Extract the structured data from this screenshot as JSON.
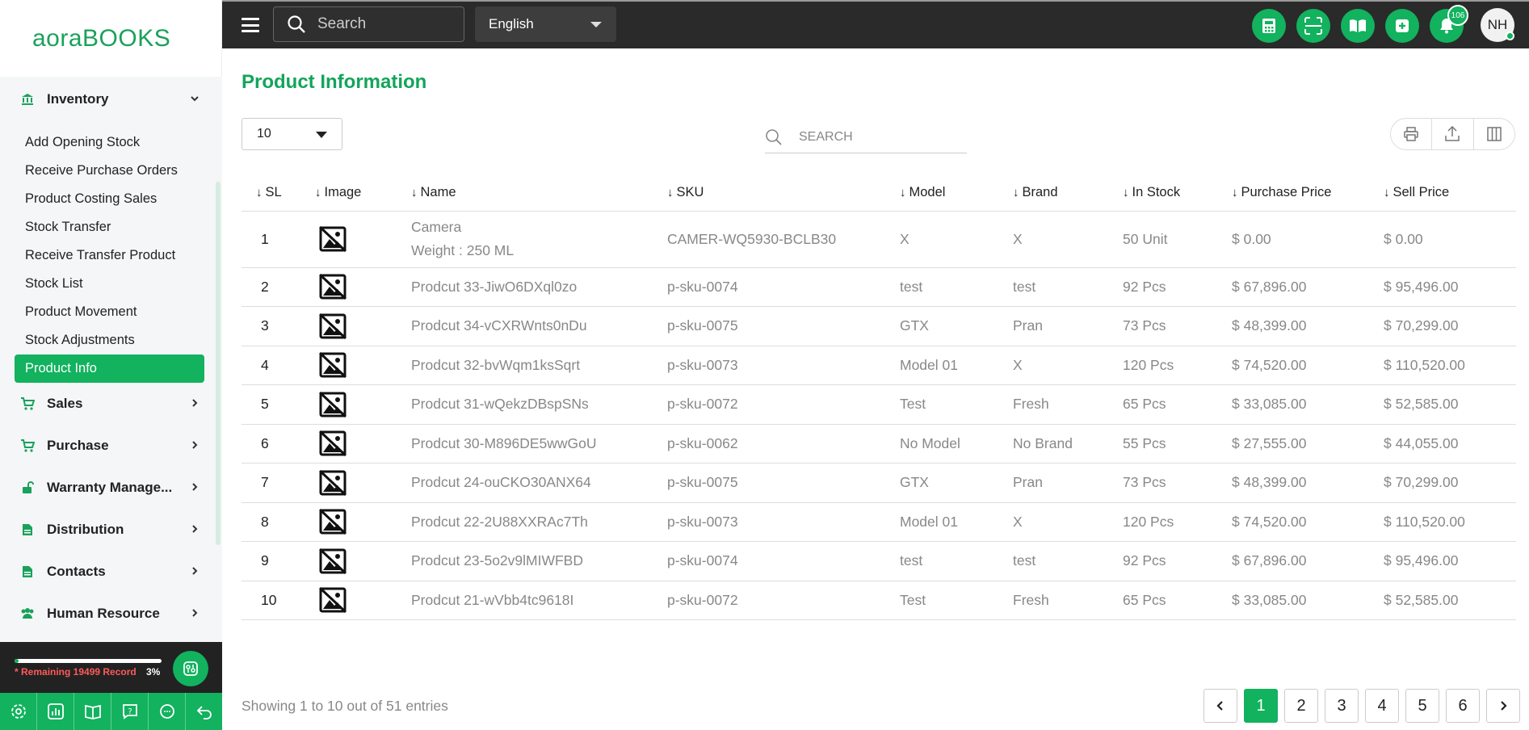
{
  "brand": {
    "logo_part1": "aora",
    "logo_part2": "BOOKS",
    "accent": "#12b25e"
  },
  "topbar": {
    "search_placeholder": "Search",
    "language": "English",
    "notification_count": "106",
    "avatar_initials": "NH"
  },
  "sidebar": {
    "groups": [
      {
        "label": "Inventory",
        "icon": "bank-icon",
        "expanded": true
      },
      {
        "label": "Sales",
        "icon": "cart-icon"
      },
      {
        "label": "Purchase",
        "icon": "cart-icon"
      },
      {
        "label": "Warranty Manage...",
        "icon": "unlock-icon"
      },
      {
        "label": "Distribution",
        "icon": "document-icon"
      },
      {
        "label": "Contacts",
        "icon": "document-icon"
      },
      {
        "label": "Human Resource",
        "icon": "users-icon"
      }
    ],
    "inventory_items": [
      "Add Opening Stock",
      "Receive Purchase Orders",
      "Product Costing Sales",
      "Stock Transfer",
      "Receive Transfer Product",
      "Stock List",
      "Product Movement",
      "Stock Adjustments",
      "Product Info"
    ],
    "active_item": "Product Info",
    "usage": {
      "remaining_text": "* Remaining 19499 Record",
      "percent_text": "3%",
      "percent": 3
    }
  },
  "main": {
    "title": "Product Information",
    "per_page": "10",
    "search_placeholder": "SEARCH",
    "columns": [
      "SL",
      "Image",
      "Name",
      "SKU",
      "Model",
      "Brand",
      "In Stock",
      "Purchase Price",
      "Sell Price"
    ],
    "rows": [
      {
        "sl": "1",
        "name": "Camera",
        "name2": "Weight : 250 ML",
        "sku": "CAMER-WQ5930-BCLB30",
        "model": "X",
        "brand": "X",
        "stock": "50 Unit",
        "purchase": "$ 0.00",
        "sell": "$ 0.00"
      },
      {
        "sl": "2",
        "name": "Prodcut 33-JiwO6DXql0zo",
        "sku": "p-sku-0074",
        "model": "test",
        "brand": "test",
        "stock": "92 Pcs",
        "purchase": "$ 67,896.00",
        "sell": "$ 95,496.00"
      },
      {
        "sl": "3",
        "name": "Prodcut 34-vCXRWnts0nDu",
        "sku": "p-sku-0075",
        "model": "GTX",
        "brand": "Pran",
        "stock": "73 Pcs",
        "purchase": "$ 48,399.00",
        "sell": "$ 70,299.00"
      },
      {
        "sl": "4",
        "name": "Prodcut 32-bvWqm1ksSqrt",
        "sku": "p-sku-0073",
        "model": "Model 01",
        "brand": "X",
        "stock": "120 Pcs",
        "purchase": "$ 74,520.00",
        "sell": "$ 110,520.00"
      },
      {
        "sl": "5",
        "name": "Prodcut 31-wQekzDBspSNs",
        "sku": "p-sku-0072",
        "model": "Test",
        "brand": "Fresh",
        "stock": "65 Pcs",
        "purchase": "$ 33,085.00",
        "sell": "$ 52,585.00"
      },
      {
        "sl": "6",
        "name": "Prodcut 30-M896DE5wwGoU",
        "sku": "p-sku-0062",
        "model": "No Model",
        "brand": "No Brand",
        "stock": "55 Pcs",
        "purchase": "$ 27,555.00",
        "sell": "$ 44,055.00"
      },
      {
        "sl": "7",
        "name": "Prodcut 24-ouCKO30ANX64",
        "sku": "p-sku-0075",
        "model": "GTX",
        "brand": "Pran",
        "stock": "73 Pcs",
        "purchase": "$ 48,399.00",
        "sell": "$ 70,299.00"
      },
      {
        "sl": "8",
        "name": "Prodcut 22-2U88XXRAc7Th",
        "sku": "p-sku-0073",
        "model": "Model 01",
        "brand": "X",
        "stock": "120 Pcs",
        "purchase": "$ 74,520.00",
        "sell": "$ 110,520.00"
      },
      {
        "sl": "9",
        "name": "Prodcut 23-5o2v9lMIWFBD",
        "sku": "p-sku-0074",
        "model": "test",
        "brand": "test",
        "stock": "92 Pcs",
        "purchase": "$ 67,896.00",
        "sell": "$ 95,496.00"
      },
      {
        "sl": "10",
        "name": "Prodcut 21-wVbb4tc9618I",
        "sku": "p-sku-0072",
        "model": "Test",
        "brand": "Fresh",
        "stock": "65 Pcs",
        "purchase": "$ 33,085.00",
        "sell": "$ 52,585.00"
      }
    ],
    "showing": "Showing 1 to 10 out of 51 entries",
    "pages": [
      "1",
      "2",
      "3",
      "4",
      "5",
      "6"
    ],
    "current_page": "1"
  }
}
